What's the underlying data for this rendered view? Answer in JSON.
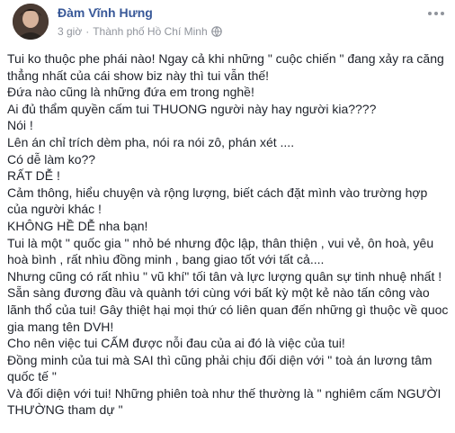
{
  "post": {
    "author": "Đàm Vĩnh Hưng",
    "time": "3 giờ",
    "location": "Thành phố Hồ Chí Minh",
    "separator": "·",
    "privacy_icon": "globe-icon",
    "more_icon": "more-options-icon",
    "lines": [
      "Tui ko thuộc phe phái nào! Ngay cả khi những \" cuộc chiến \" đang xảy ra căng",
      "thẳng nhất của cái show biz này thì tui vẫn thế!",
      "Đứa nào cũng là những đứa em trong nghề!",
      "Ai đủ thẩm quyền cấm tui THUONG người này hay người kia????",
      "Nói !",
      "Lên án chỉ trích dèm pha, nói ra nói zô, phán xét ....",
      "Có dễ làm ko??",
      "RẤT DỄ !",
      "Cảm thông, hiểu chuyện và rộng lượng, biết cách đặt mình vào trường hợp",
      "của người khác !",
      "KHÔNG HỀ DỄ nha bạn!",
      "Tui là một \" quốc gia \" nhỏ bé nhưng độc lập, thân thiện , vui vẻ, ôn hoà, yêu",
      "hoà bình , rất nhìu đồng minh , bang giao tốt với tất cả....",
      "Nhưng cũng có rất nhìu \" vũ khí\" tối tân và lực lượng quân sự tinh nhuệ nhất !",
      "Sẵn sàng đương đầu và quành tới cùng với bất kỳ một kẻ nào tấn công vào",
      "lãnh thổ của tui! Gây thiệt hại mọi thứ có liên quan đến những gì thuộc về quoc",
      "gia mang tên DVH!",
      "Cho nên việc tui CẤM được nỗi đau của ai đó là việc của tui!",
      "Đồng minh của tui mà SAI thì cũng phải chịu đối diện với \" toà án lương tâm",
      "quốc tế \"",
      "Và đối diện với tui! Những phiên toà như thế thường là \" nghiêm cấm NGƯỜI",
      "THƯỜNG tham dự \""
    ]
  },
  "colors": {
    "author": "#385898",
    "meta": "#90949c",
    "text": "#1d2129"
  }
}
